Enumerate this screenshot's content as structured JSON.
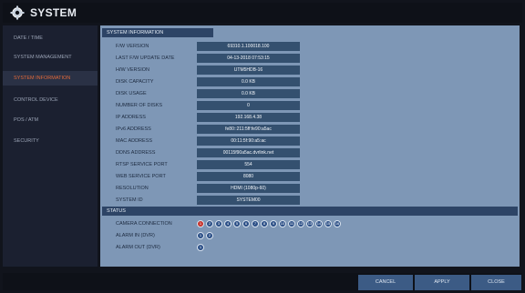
{
  "window": {
    "title": "SYSTEM"
  },
  "sidebar": {
    "items": [
      {
        "label": "DATE / TIME"
      },
      {
        "label": "SYSTEM MANAGEMENT"
      },
      {
        "label": "SYSTEM INFORMATION",
        "active": true
      },
      {
        "label": "CONTROL DEVICE"
      },
      {
        "label": "POS / ATM"
      },
      {
        "label": "SECURITY"
      }
    ]
  },
  "system_info": {
    "header": "SYSTEM INFORMATION",
    "rows": [
      {
        "label": "F/W VERSION",
        "value": "69310.1.100018.100"
      },
      {
        "label": "LAST F/W UPDATE DATE",
        "value": "04-13-2018 07:53:15"
      },
      {
        "label": "H/W VERSION",
        "value": "UTM5HDB-16"
      },
      {
        "label": "DISK CAPACITY",
        "value": "0.0 KB"
      },
      {
        "label": "DISK USAGE",
        "value": "0.0 KB"
      },
      {
        "label": "NUMBER OF DISKS",
        "value": "0"
      },
      {
        "label": "IP ADDRESS",
        "value": "192.168.4.38"
      },
      {
        "label": "IPv6 ADDRESS",
        "value": "fe80::211:5ff:fe90:a5ac"
      },
      {
        "label": "MAC ADDRESS",
        "value": "00:11:5f:90:a5:ac"
      },
      {
        "label": "DDNS ADDRESS",
        "value": "00115f90a5ac.dvrlink.net"
      },
      {
        "label": "RTSP SERVICE PORT",
        "value": "554"
      },
      {
        "label": "WEB SERVICE PORT",
        "value": "8080"
      },
      {
        "label": "RESOLUTION",
        "value": "HDMI (1080p-60)"
      },
      {
        "label": "SYSTEM ID",
        "value": "SYSTEM00"
      }
    ]
  },
  "status": {
    "header": "STATUS",
    "camera_connection": {
      "label": "CAMERA CONNECTION",
      "channels": [
        "1",
        "2",
        "3",
        "4",
        "5",
        "6",
        "7",
        "8",
        "9",
        "10",
        "11",
        "12",
        "13",
        "14",
        "15",
        "16"
      ],
      "red_channels": [
        1
      ]
    },
    "alarm_in": {
      "label": "ALARM IN (DVR)",
      "channels": [
        "1",
        "2"
      ]
    },
    "alarm_out": {
      "label": "ALARM OUT (DVR)",
      "channels": [
        "1"
      ]
    }
  },
  "footer": {
    "cancel": "CANCEL",
    "apply": "APPLY",
    "close": "CLOSE"
  },
  "colors": {
    "accent_active": "#e46a3a",
    "panel": "#7e97b6",
    "value_box": "#34506f",
    "header": "#2d4466"
  }
}
